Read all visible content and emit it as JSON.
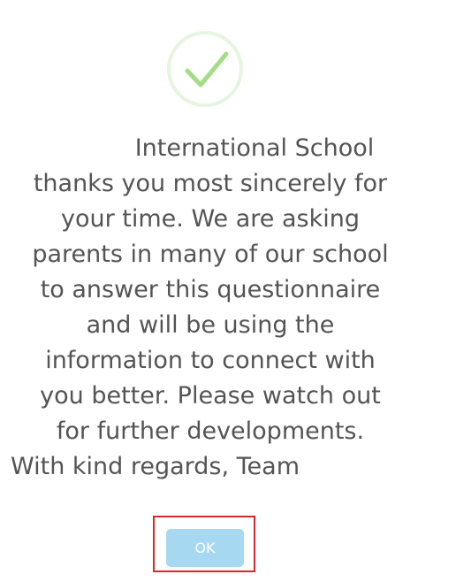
{
  "dialog": {
    "icon": "checkmark-success-icon",
    "message_lines": [
      "International School",
      "thanks you most sincerely for",
      "your time. We are asking",
      "parents in many of our school",
      "to answer this questionnaire",
      "and will be using the",
      "information to connect with",
      "you better. Please watch out",
      "for further developments.",
      "With kind regards, Team"
    ],
    "ok_label": "OK"
  },
  "colors": {
    "icon_ring": "#e6f5df",
    "icon_check": "#a5dc86",
    "text": "#545454",
    "button_bg": "#a6d8f2",
    "button_text": "#ffffff",
    "highlight": "#d8272f"
  }
}
